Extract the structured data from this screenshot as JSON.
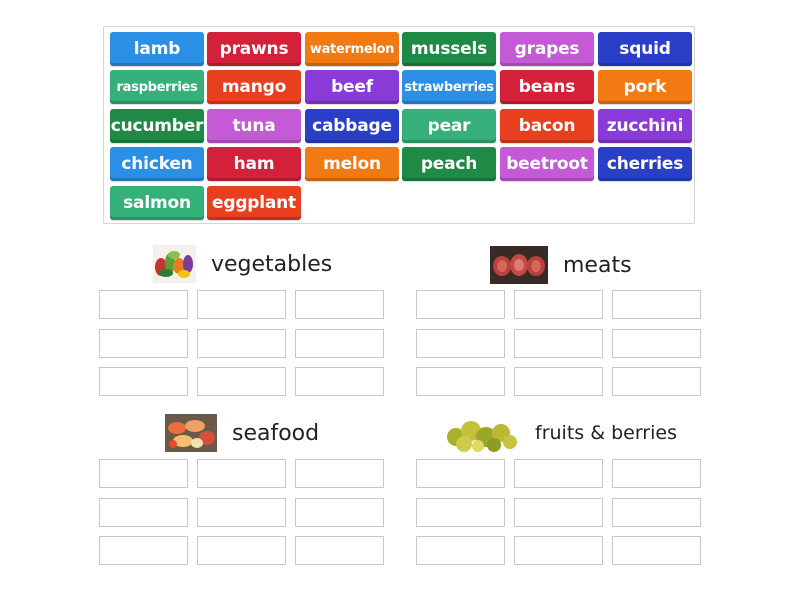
{
  "tiles": [
    {
      "label": "lamb",
      "color": "#2b8fe6"
    },
    {
      "label": "prawns",
      "color": "#d4213a"
    },
    {
      "label": "watermelon",
      "color": "#f27a12"
    },
    {
      "label": "mussels",
      "color": "#1e8a45"
    },
    {
      "label": "grapes",
      "color": "#c45ad6"
    },
    {
      "label": "squid",
      "color": "#2a3fc8"
    },
    {
      "label": "raspberries",
      "color": "#35b07a"
    },
    {
      "label": "mango",
      "color": "#e8401e"
    },
    {
      "label": "beef",
      "color": "#8a3ad8"
    },
    {
      "label": "strawberries",
      "color": "#2b8fe6"
    },
    {
      "label": "beans",
      "color": "#d4213a"
    },
    {
      "label": "pork",
      "color": "#f27a12"
    },
    {
      "label": "cucumber",
      "color": "#1e8a45"
    },
    {
      "label": "tuna",
      "color": "#c45ad6"
    },
    {
      "label": "cabbage",
      "color": "#2a3fc8"
    },
    {
      "label": "pear",
      "color": "#35b07a"
    },
    {
      "label": "bacon",
      "color": "#e8401e"
    },
    {
      "label": "zucchini",
      "color": "#8a3ad8"
    },
    {
      "label": "chicken",
      "color": "#2b8fe6"
    },
    {
      "label": "ham",
      "color": "#d4213a"
    },
    {
      "label": "melon",
      "color": "#f27a12"
    },
    {
      "label": "peach",
      "color": "#1e8a45"
    },
    {
      "label": "beetroot",
      "color": "#c45ad6"
    },
    {
      "label": "cherries",
      "color": "#2a3fc8"
    },
    {
      "label": "salmon",
      "color": "#35b07a"
    },
    {
      "label": "eggplant",
      "color": "#e8401e"
    }
  ],
  "groups": [
    {
      "title": "vegetables",
      "thumbnail": "vegetables-photo",
      "slots": 9
    },
    {
      "title": "meats",
      "thumbnail": "meat-steaks-photo",
      "slots": 9
    },
    {
      "title": "seafood",
      "thumbnail": "seafood-platter-photo",
      "slots": 9
    },
    {
      "title": "fruits & berries",
      "thumbnail": "green-fruits-photo",
      "slots": 9
    }
  ]
}
